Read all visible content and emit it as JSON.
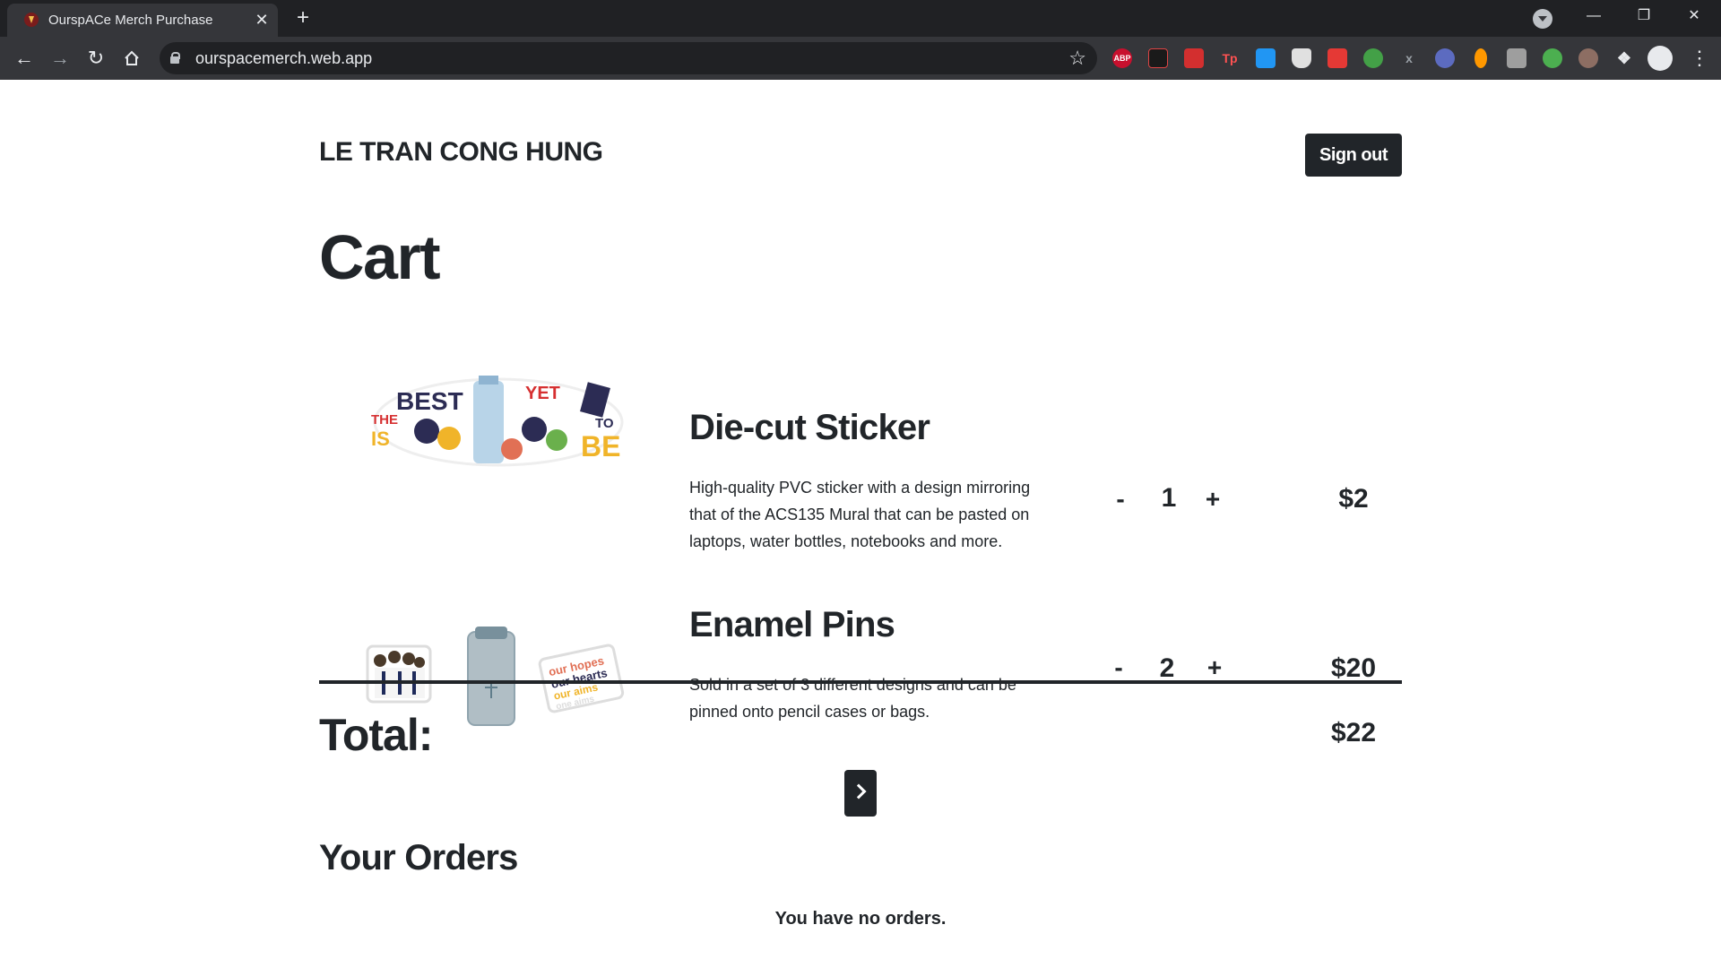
{
  "browser": {
    "tab_title": "OurspACe Merch Purchase",
    "url": "ourspacemerch.web.app",
    "new_tab": "+",
    "close_tab": "✕",
    "extensions": [
      "ABP",
      "",
      "",
      "Tp",
      "",
      "",
      "",
      "",
      "",
      "",
      "",
      "",
      "",
      ""
    ],
    "window_controls": [
      "—",
      "❐",
      "✕"
    ]
  },
  "header": {
    "user_name": "LE TRAN CONG HUNG",
    "signout_label": "Sign out"
  },
  "cart": {
    "title": "Cart",
    "items": [
      {
        "name": "Die-cut Sticker",
        "description": "High-quality PVC sticker with a design mirroring that of the ACS135 Mural that can be pasted on laptops, water bottles, notebooks and more.",
        "qty_minus": "-",
        "quantity": "1",
        "qty_plus": "+",
        "price": "$2",
        "image_text": {
          "the": "THE",
          "best": "BEST",
          "yet": "YET",
          "is": "IS",
          "to": "TO",
          "be": "BE"
        }
      },
      {
        "name": "Enamel Pins",
        "description": "Sold in a set of 3 different designs and can be pinned onto pencil cases or bags.",
        "qty_minus": "-",
        "quantity": "2",
        "qty_plus": "+",
        "price": "$20",
        "image_text": {
          "line1": "our hopes",
          "line2": "our hearts",
          "line3": "our aims",
          "line4": "one aims"
        }
      }
    ],
    "total_label": "Total:",
    "total_value": "$22"
  },
  "orders": {
    "title": "Your Orders",
    "empty_text": "You have no orders."
  },
  "colors": {
    "dark": "#212529",
    "chrome_bg": "#202124",
    "chrome_toolbar": "#35363a"
  }
}
